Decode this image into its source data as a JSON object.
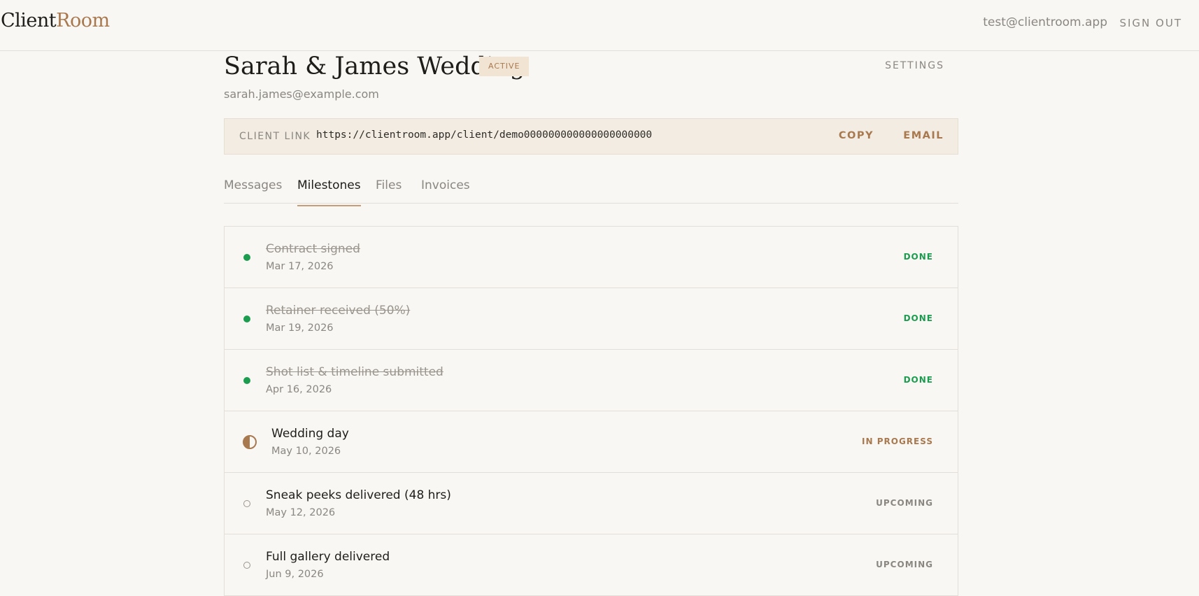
{
  "header": {
    "logo_part1": "Client",
    "logo_part2": "Room",
    "user_email": "test@clientroom.app",
    "sign_out": "SIGN OUT"
  },
  "project": {
    "title": "Sarah & James Wedding",
    "badge": "ACTIVE",
    "settings": "SETTINGS",
    "client_email": "sarah.james@example.com"
  },
  "client_link": {
    "label": "CLIENT LINK",
    "url": "https://clientroom.app/client/demo000000000000000000000",
    "copy": "COPY",
    "email": "EMAIL"
  },
  "tabs": [
    {
      "label": "Messages",
      "active": false
    },
    {
      "label": "Milestones",
      "active": true
    },
    {
      "label": "Files",
      "active": false
    },
    {
      "label": "Invoices",
      "active": false
    }
  ],
  "milestones": [
    {
      "title": "Contract signed",
      "date": "Mar 17, 2026",
      "status": "DONE",
      "state": "done"
    },
    {
      "title": "Retainer received (50%)",
      "date": "Mar 19, 2026",
      "status": "DONE",
      "state": "done"
    },
    {
      "title": "Shot list & timeline submitted",
      "date": "Apr 16, 2026",
      "status": "DONE",
      "state": "done"
    },
    {
      "title": "Wedding day",
      "date": "May 10, 2026",
      "status": "IN PROGRESS",
      "state": "progress"
    },
    {
      "title": "Sneak peeks delivered (48 hrs)",
      "date": "May 12, 2026",
      "status": "UPCOMING",
      "state": "upcoming"
    },
    {
      "title": "Full gallery delivered",
      "date": "Jun 9, 2026",
      "status": "UPCOMING",
      "state": "upcoming"
    }
  ],
  "colors": {
    "accent": "#a8794f",
    "done": "#1c9c4f",
    "background": "#f9f7f4"
  }
}
